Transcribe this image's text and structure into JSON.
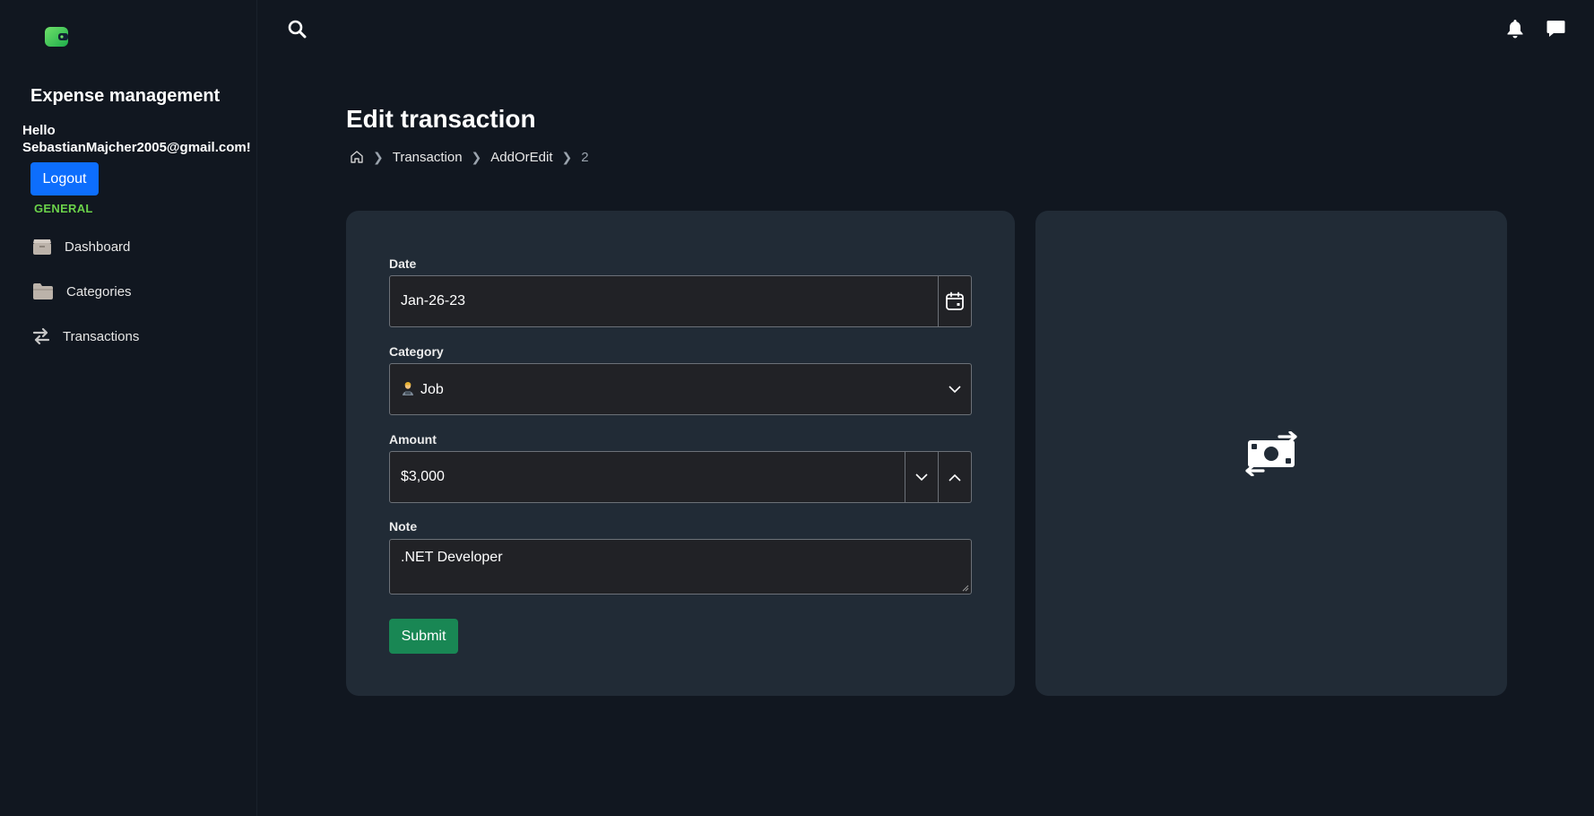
{
  "app": {
    "title": "Expense management",
    "greeting": "Hello SebastianMajcher2005@gmail.com!",
    "logout_label": "Logout",
    "logo_icon": "wallet-icon"
  },
  "sidebar": {
    "section_label": "GENERAL",
    "items": [
      {
        "label": "Dashboard",
        "icon": "box-icon"
      },
      {
        "label": "Categories",
        "icon": "folder-icon"
      },
      {
        "label": "Transactions",
        "icon": "arrows-exchange-icon"
      }
    ]
  },
  "topbar": {
    "icons": [
      "search-icon",
      "bell-icon",
      "chat-icon"
    ]
  },
  "page": {
    "title": "Edit transaction",
    "breadcrumb": [
      "Transaction",
      "AddOrEdit",
      "2"
    ]
  },
  "form": {
    "date": {
      "label": "Date",
      "value": "Jan-26-23"
    },
    "category": {
      "label": "Category",
      "value": "Job",
      "icon": "worker-emoji"
    },
    "amount": {
      "label": "Amount",
      "value": "$3,000"
    },
    "note": {
      "label": "Note",
      "value": ".NET Developer"
    },
    "submit_label": "Submit"
  },
  "illustration": {
    "icon": "money-transfer-icon"
  },
  "colors": {
    "background": "#111720",
    "card": "#212b36",
    "primary": "#0d6efd",
    "success": "#198754",
    "section_green": "#6bd24a"
  }
}
